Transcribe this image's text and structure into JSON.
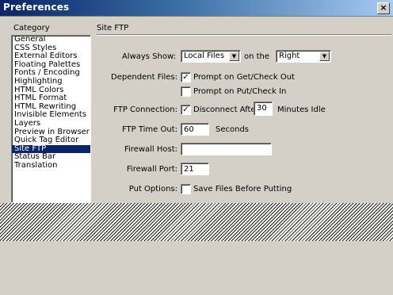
{
  "window": {
    "title": "Preferences",
    "close_label": "×"
  },
  "category": {
    "label": "Category",
    "items": [
      "General",
      "CSS Styles",
      "External Editors",
      "Floating Palettes",
      "Fonts / Encoding",
      "Highlighting",
      "HTML Colors",
      "HTML Format",
      "HTML Rewriting",
      "Invisible Elements",
      "Layers",
      "Preview in Browser",
      "Quick Tag Editor",
      "Site FTP",
      "Status Bar",
      "Translation"
    ],
    "selected": "Site FTP"
  },
  "section": {
    "title": "Site FTP",
    "always_show_label": "Always Show:",
    "always_show_value": "Local Files",
    "on_the_label": "on the",
    "side_value": "Right",
    "dependent_files_label": "Dependent Files:",
    "prompt_get_label": "Prompt on Get/Check Out",
    "prompt_get_checked": true,
    "prompt_put_label": "Prompt on Put/Check In",
    "prompt_put_checked": false,
    "ftp_connection_label": "FTP Connection:",
    "disconnect_label": "Disconnect After",
    "disconnect_checked": true,
    "disconnect_value": "30",
    "minutes_idle_label": "Minutes Idle",
    "ftp_timeout_label": "FTP Time Out:",
    "ftp_timeout_value": "60",
    "seconds_label": "Seconds",
    "firewall_host_label": "Firewall Host:",
    "firewall_host_value": "",
    "firewall_port_label": "Firewall Port:",
    "firewall_port_value": "21",
    "put_options_label": "Put Options:",
    "save_files_label": "Save Files Before Putting",
    "save_files_checked": false
  }
}
